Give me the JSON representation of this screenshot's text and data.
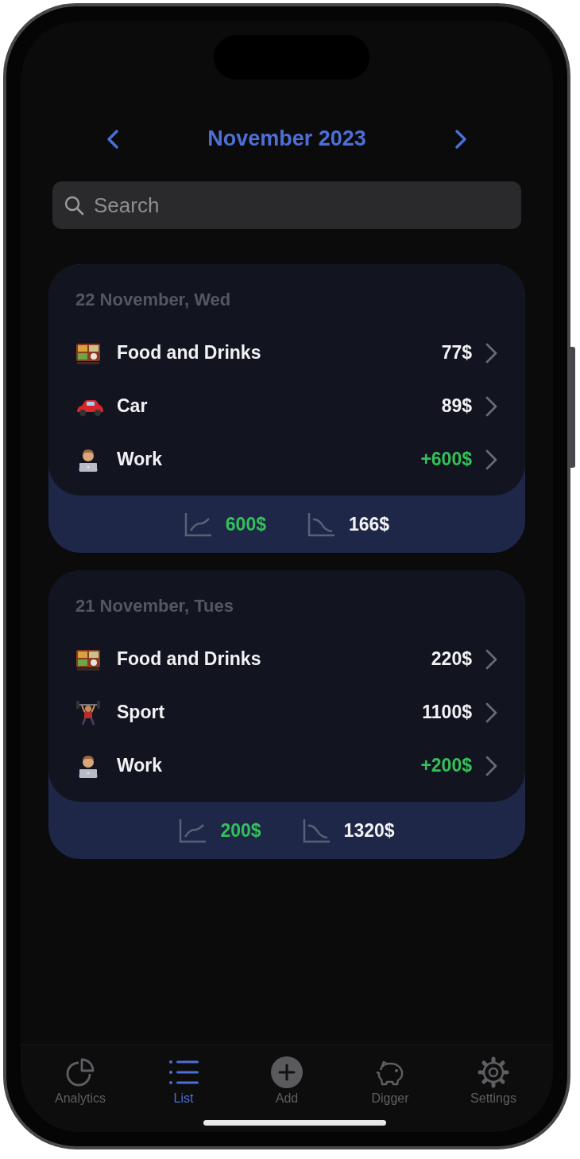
{
  "header": {
    "title": "November 2023"
  },
  "search": {
    "placeholder": "Search"
  },
  "days": [
    {
      "date": "22 November, Wed",
      "entries": [
        {
          "category": "Food and Drinks",
          "kind": "food",
          "amount": "77$",
          "income": false
        },
        {
          "category": "Car",
          "kind": "car",
          "amount": "89$",
          "income": false
        },
        {
          "category": "Work",
          "kind": "work",
          "amount": "+600$",
          "income": true
        }
      ],
      "income_total": "600$",
      "expense_total": "166$"
    },
    {
      "date": "21 November, Tues",
      "entries": [
        {
          "category": "Food and Drinks",
          "kind": "food",
          "amount": "220$",
          "income": false
        },
        {
          "category": "Sport",
          "kind": "sport",
          "amount": "1100$",
          "income": false
        },
        {
          "category": "Work",
          "kind": "work",
          "amount": "+200$",
          "income": true
        }
      ],
      "income_total": "200$",
      "expense_total": "1320$"
    }
  ],
  "tab_bar": [
    {
      "label": "Analytics",
      "kind": "pie",
      "selected": false
    },
    {
      "label": "List",
      "kind": "list",
      "selected": true
    },
    {
      "label": "Add",
      "kind": "add",
      "selected": false
    },
    {
      "label": "Digger",
      "kind": "piggy",
      "selected": false
    },
    {
      "label": "Settings",
      "kind": "gear",
      "selected": false
    }
  ]
}
